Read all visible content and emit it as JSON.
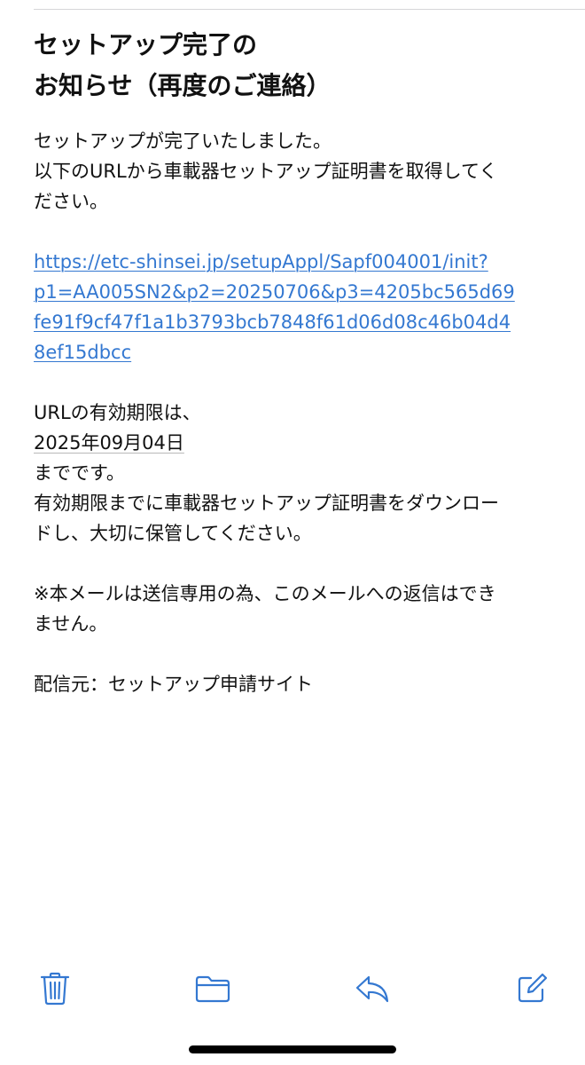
{
  "email": {
    "subject_lines": [
      "セットアップ完了の",
      "お知らせ（再度のご連絡）"
    ],
    "intro_lines": [
      "セットアップが完了いたしました。",
      "以下のURLから車載器セットアップ証明書を取得してく",
      "ださい。"
    ],
    "link_lines": [
      "https://etc-shinsei.jp/setupAppl/Sapf004001/init?",
      "p1=AA005SN2&p2=20250706&p3=4205bc565d69",
      "fe91f9cf47f1a1b3793bcb7848f61d06d08c46b04d4",
      "8ef15dbcc"
    ],
    "expiry": {
      "prefix": "URLの有効期限は、",
      "date": "2025年09月04日",
      "suffix": "までです。",
      "line2": "有効期限までに車載器セットアップ証明書をダウンロー",
      "line3": "ドし、大切に保管してください。"
    },
    "notice_lines": [
      "※本メールは送信専用の為、このメールへの返信はでき",
      "ません。"
    ],
    "sender": "配信元：セットアップ申請サイト"
  },
  "toolbar": {
    "icons": [
      "trash-icon",
      "folder-icon",
      "reply-icon",
      "compose-icon"
    ],
    "accent_color": "#3478d1"
  },
  "colors": {
    "link": "#3478d1",
    "text": "#111111",
    "background": "#ffffff"
  }
}
